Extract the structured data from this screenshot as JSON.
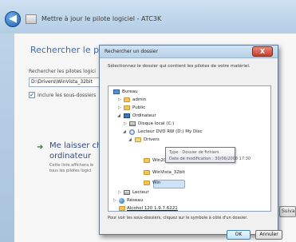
{
  "wizard": {
    "title": "Mettre à jour le pilote logiciel - ATC3K",
    "heading": "Rechercher le pilote",
    "search_label": "Rechercher les pilotes logici",
    "path_value": "D:\\Drivers\\WinVista_32bit",
    "include_subfolders_label": "Inclure les sous-dossiers",
    "include_subfolders_checked": true,
    "choose_link_line1": "Me laisser chois",
    "choose_link_line2": "ordinateur",
    "choose_desc_line1": "Cette liste affichera le",
    "choose_desc_line2": "tous les pilotes logici",
    "next_button_partial": "Suivant"
  },
  "dialog": {
    "title": "Rechercher un dossier",
    "close_label": "X",
    "instruction": "Sélectionnez le dossier qui contient les pilotes de votre matériel.",
    "tree": [
      {
        "label": "Bureau",
        "icon": "desktop-icon",
        "toggle": ""
      },
      {
        "label": "admin",
        "icon": "folder-icon",
        "toggle": "▷"
      },
      {
        "label": "Public",
        "icon": "folder-icon",
        "toggle": "▷"
      },
      {
        "label": "Ordinateur",
        "icon": "computer-icon",
        "toggle": "◢"
      },
      {
        "label": "Disque local (C:)",
        "icon": "drive-icon",
        "toggle": "▷"
      },
      {
        "label": "Lecteur DVD RW (D:) My Disc",
        "icon": "dvd-icon",
        "toggle": "◢"
      },
      {
        "label": "Drivers",
        "icon": "folder-open-icon",
        "toggle": "◢"
      },
      {
        "label": "Win2000",
        "icon": "folder-icon",
        "toggle": ""
      },
      {
        "label": "WinVista_32bit",
        "icon": "folder-icon",
        "toggle": "",
        "selected": true
      },
      {
        "label": "Win",
        "icon": "folder-icon",
        "toggle": ""
      },
      {
        "label": "Lecteur",
        "icon": "drive-icon",
        "toggle": "▷"
      },
      {
        "label": "Réseau",
        "icon": "network-icon",
        "toggle": "▷"
      },
      {
        "label": "Alcohol 120 1.9.7.6221",
        "icon": "folder-icon",
        "toggle": ""
      }
    ],
    "tooltip_line1": "Type : Dossier de fichiers",
    "tooltip_line2": "Date de modification : 30/06/2008 17:30",
    "footer": "Pour voir les sous-dossiers, cliquez sur le symbole à côté d'un dossier.",
    "ok_label": "OK",
    "cancel_label": "Annuler"
  }
}
